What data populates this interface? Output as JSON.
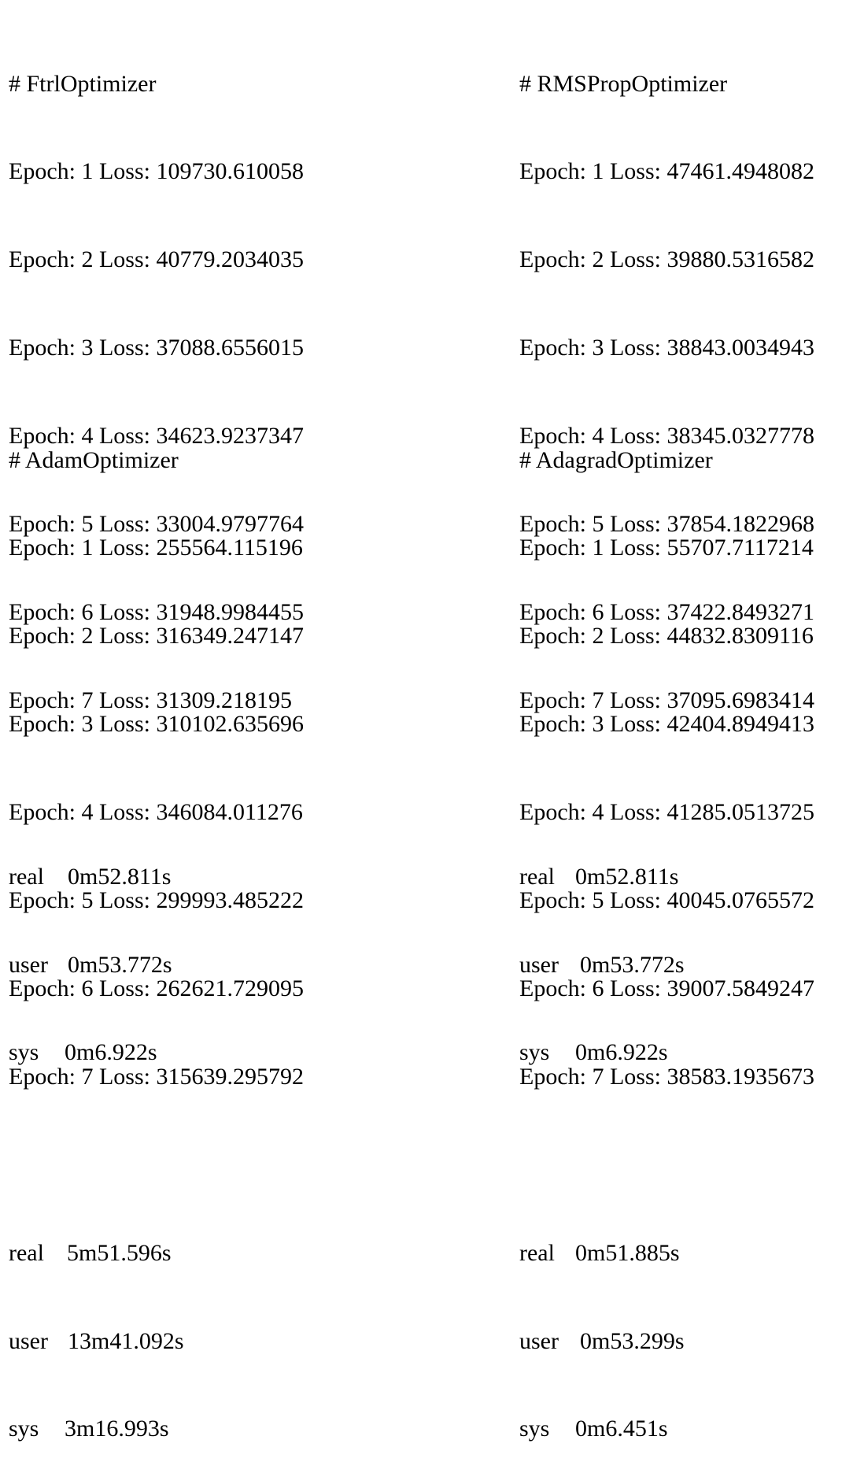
{
  "blocks": [
    {
      "title": "# FtrlOptimizer",
      "epochs": [
        "Epoch: 1 Loss: 109730.610058",
        "Epoch: 2 Loss: 40779.2034035",
        "Epoch: 3 Loss: 37088.6556015",
        "Epoch: 4 Loss: 34623.9237347",
        "Epoch: 5 Loss: 33004.9797764",
        "Epoch: 6 Loss: 31948.9984455",
        "Epoch: 7 Loss: 31309.218195"
      ],
      "timing": {
        "real_label": "real",
        "real": "0m52.811s",
        "user_label": "user",
        "user": "0m53.772s",
        "sys_label": "sys",
        "sys": "0m6.922s"
      }
    },
    {
      "title": "# RMSPropOptimizer",
      "epochs": [
        "Epoch: 1 Loss: 47461.4948082",
        "Epoch: 2 Loss: 39880.5316582",
        "Epoch: 3 Loss: 38843.0034943",
        "Epoch: 4 Loss: 38345.0327778",
        "Epoch: 5 Loss: 37854.1822968",
        "Epoch: 6 Loss: 37422.8493271",
        "Epoch: 7 Loss: 37095.6983414"
      ],
      "timing": {
        "real_label": "real",
        "real": "0m52.811s",
        "user_label": "user",
        "user": "0m53.772s",
        "sys_label": "sys",
        "sys": "0m6.922s"
      }
    },
    {
      "title": "# AdamOptimizer",
      "epochs": [
        "Epoch: 1 Loss: 255564.115196",
        "Epoch: 2 Loss: 316349.247147",
        "Epoch: 3 Loss: 310102.635696",
        "Epoch: 4 Loss: 346084.011276",
        "Epoch: 5 Loss: 299993.485222",
        "Epoch: 6 Loss: 262621.729095",
        "Epoch: 7 Loss: 315639.295792"
      ],
      "timing": {
        "real_label": "real",
        "real": "5m51.596s",
        "user_label": "user",
        "user": "13m41.092s",
        "sys_label": "sys",
        "sys": "3m16.993s"
      }
    },
    {
      "title": "# AdagradOptimizer",
      "epochs": [
        "Epoch: 1 Loss: 55707.7117214",
        "Epoch: 2 Loss: 44832.8309116",
        "Epoch: 3 Loss: 42404.8949413",
        "Epoch: 4 Loss: 41285.0513725",
        "Epoch: 5 Loss: 40045.0765572",
        "Epoch: 6 Loss: 39007.5849247",
        "Epoch: 7 Loss: 38583.1935673"
      ],
      "timing": {
        "real_label": "real",
        "real": "0m51.885s",
        "user_label": "user",
        "user": "0m53.299s",
        "sys_label": "sys",
        "sys": "0m6.451s"
      }
    }
  ]
}
